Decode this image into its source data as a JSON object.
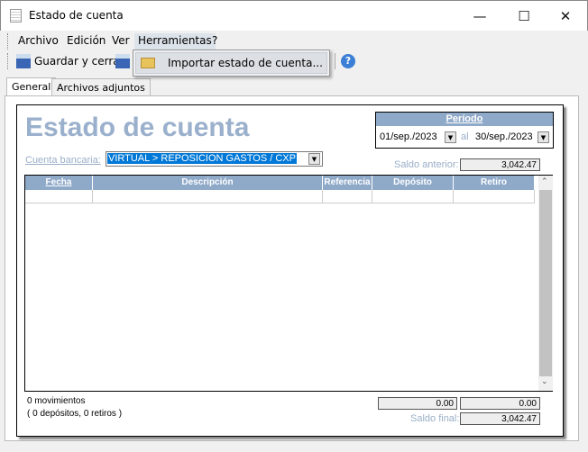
{
  "window": {
    "title": "Estado de cuenta",
    "icon": "document-icon"
  },
  "menu": [
    {
      "label": "Archivo"
    },
    {
      "label": "Edición"
    },
    {
      "label": "Ver"
    },
    {
      "label": "Herramientas"
    },
    {
      "label": "?"
    }
  ],
  "toolbar": {
    "save_close": "Guardar y cerrar",
    "help_icon": "help-icon"
  },
  "dropdown": {
    "import": "Importar estado de cuenta..."
  },
  "tabs": [
    {
      "label": "General"
    },
    {
      "label": "Archivos adjuntos"
    }
  ],
  "form": {
    "title": "Estado de cuenta",
    "period_label": "Período",
    "date_from": "01/sep./2023",
    "date_sep": "al",
    "date_to": "30/sep./2023",
    "account_label": "Cuenta bancaria:",
    "account_value": "VIRTUAL > REPOSICION GASTOS / CXP",
    "prev_balance_label": "Saldo anterior:",
    "prev_balance": "3,042.47"
  },
  "table": {
    "columns": [
      "Fecha",
      "Descripción",
      "Referencia",
      "Depósito",
      "Retiro"
    ],
    "rows": []
  },
  "footer": {
    "movements": "0 movimientos",
    "detail": "( 0 depósitos, 0 retiros )",
    "total_deposits": "0.00",
    "total_withdrawals": "0.00",
    "final_label": "Saldo final:",
    "final_balance": "3,042.47"
  },
  "colors": {
    "accent": "#8fa9c9",
    "title": "#9ab0cc",
    "selection": "#0078d7"
  }
}
